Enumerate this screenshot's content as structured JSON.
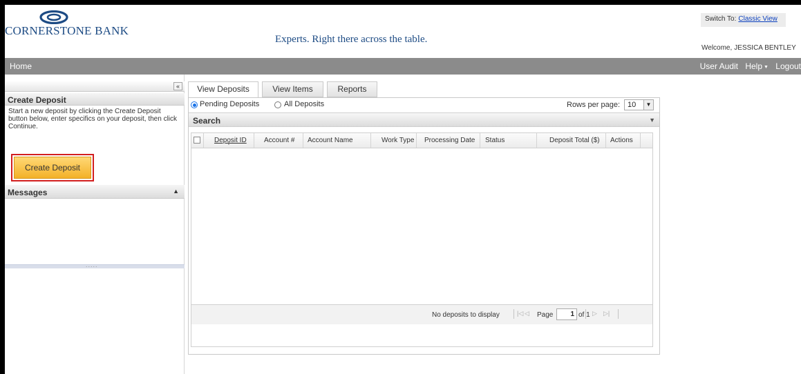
{
  "header": {
    "logo_text": "CORNERSTONE BANK",
    "tagline": "Experts.  Right there across the table.",
    "switch_label": "Switch To:",
    "switch_link": "Classic View",
    "welcome_label": "Welcome,",
    "welcome_name": "JESSICA BENTLEY"
  },
  "nav": {
    "home": "Home",
    "user_audit": "User Audit",
    "help": "Help",
    "help_caret": "▼",
    "logout": "Logout"
  },
  "sidebar": {
    "collapse_icon": "«",
    "create_deposit_title": "Create Deposit",
    "create_deposit_text": "Start a new deposit by clicking the Create Deposit button below, enter specifics on your deposit, then click Continue.",
    "create_deposit_button": "Create Deposit",
    "messages_title": "Messages",
    "messages_toggle": "▲",
    "splitter_dots": "....."
  },
  "tabs": [
    {
      "label": "View Deposits",
      "active": true
    },
    {
      "label": "View Items",
      "active": false
    },
    {
      "label": "Reports",
      "active": false
    }
  ],
  "filters": {
    "pending": "Pending Deposits",
    "all": "All Deposits",
    "selected": "pending",
    "rows_per_page_label": "Rows per page:",
    "rows_per_page_value": "10",
    "rows_per_page_arrow": "▼"
  },
  "search": {
    "title": "Search",
    "toggle": "▼"
  },
  "grid": {
    "columns": [
      "Deposit ID",
      "Account #",
      "Account Name",
      "Work Type",
      "Processing Date",
      "Status",
      "Deposit Total ($)",
      "Actions"
    ],
    "sort_indicator": "▼",
    "rows": []
  },
  "pager": {
    "empty_message": "No deposits to display",
    "first_icon": "|◁",
    "prev_icon": "◁",
    "page_label": "Page",
    "page_value": "1",
    "of_label": "of 1",
    "next_icon": "▷",
    "last_icon": "▷|"
  },
  "colors": {
    "brand_blue": "#1d4b84",
    "nav_gray": "#8b8b8b",
    "button_orange": "#f3b128",
    "highlight_red": "#d21e1e",
    "link_blue": "#0a3fbe"
  }
}
